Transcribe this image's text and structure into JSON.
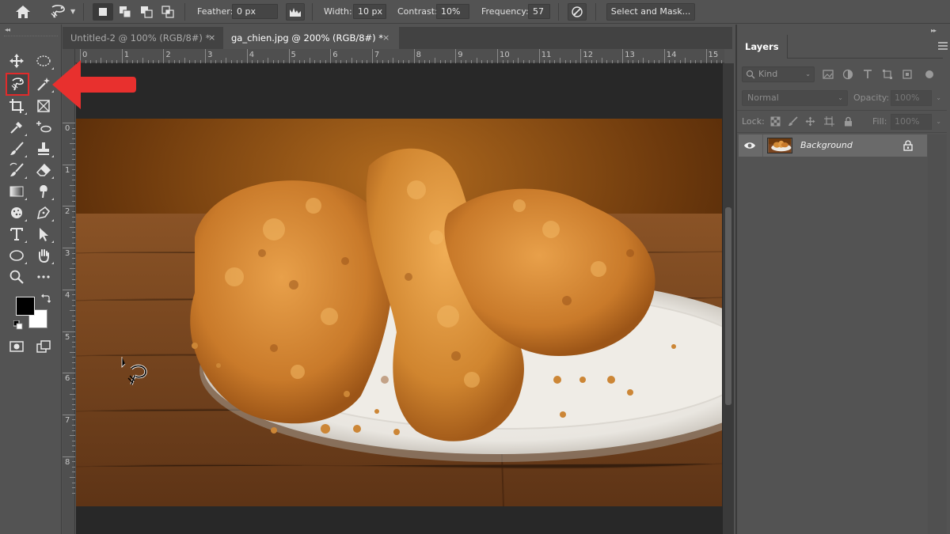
{
  "options_bar": {
    "feather_label": "Feather:",
    "feather_value": "0 px",
    "width_label": "Width:",
    "width_value": "10 px",
    "contrast_label": "Contrast:",
    "contrast_value": "10%",
    "frequency_label": "Frequency:",
    "frequency_value": "57",
    "select_mask_label": "Select and Mask..."
  },
  "tabs": [
    {
      "label": "Untitled-2 @ 100% (RGB/8#) *",
      "active": false
    },
    {
      "label": "ga_chien.jpg @ 200% (RGB/8#) *",
      "active": true
    }
  ],
  "tab_close_glyph": "×",
  "ruler": {
    "h_labels": [
      "0",
      "1",
      "2",
      "3",
      "4",
      "5",
      "6",
      "7",
      "8",
      "9",
      "10",
      "11",
      "12",
      "13",
      "14",
      "15"
    ],
    "v_labels": [
      "0",
      "1",
      "2",
      "3",
      "4",
      "5",
      "6",
      "7",
      "8"
    ]
  },
  "toolbar": {
    "highlighted_tool": "magnetic-lasso",
    "foreground_color": "#000000",
    "background_color": "#ffffff"
  },
  "annotation": {
    "arrow_color": "#e8302e"
  },
  "layers_panel": {
    "tab_label": "Layers",
    "kind_label": "Kind",
    "blend_mode": "Normal",
    "opacity_label": "Opacity:",
    "opacity_value": "100%",
    "lock_label": "Lock:",
    "fill_label": "Fill:",
    "fill_value": "100%",
    "layers": [
      {
        "name": "Background",
        "visible": true,
        "locked": true
      }
    ]
  }
}
